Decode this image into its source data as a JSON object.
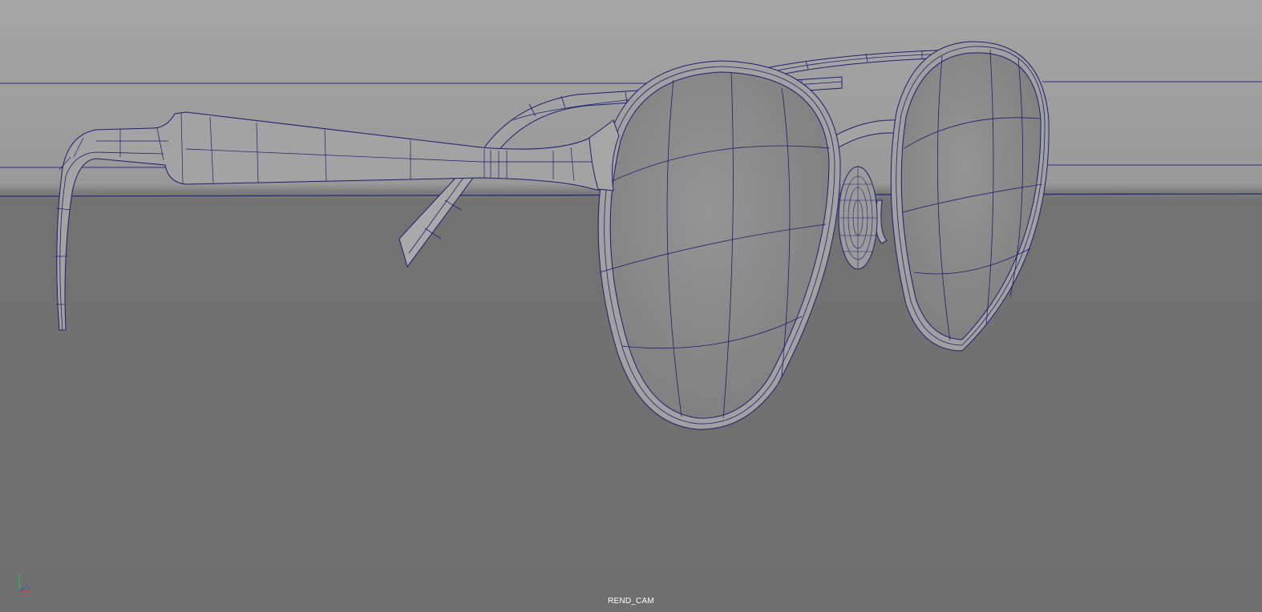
{
  "viewport": {
    "camera_label": "REND_CAM",
    "model": "sunglasses-wireframe",
    "display_mode": "wireframe-on-shaded"
  },
  "colors": {
    "background_top": "#a3a3a3",
    "background_bottom": "#717171",
    "wire": "#1e1e6e",
    "surface": "#9a9a9a",
    "lens": "#8c8c8c",
    "label": "#ffffff"
  },
  "icons": {
    "axis_gizmo": "xyz-axis-icon"
  }
}
